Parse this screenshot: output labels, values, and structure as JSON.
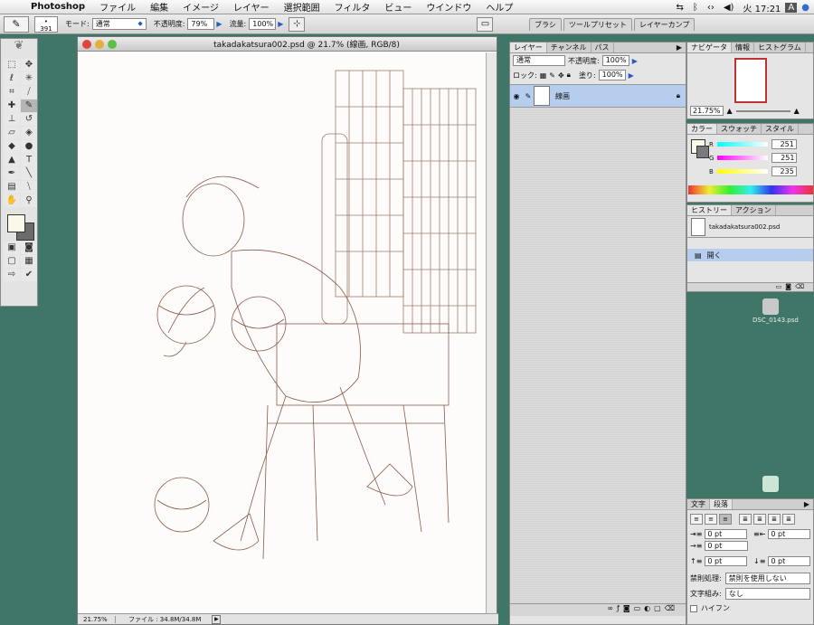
{
  "menubar": {
    "app": "Photoshop",
    "items": [
      "ファイル",
      "編集",
      "イメージ",
      "レイヤー",
      "選択範囲",
      "フィルタ",
      "ビュー",
      "ウインドウ",
      "ヘルプ"
    ],
    "clock": "火 17:21",
    "input_indicator": "A"
  },
  "options": {
    "brush_size": "391",
    "mode_label": "モード:",
    "mode_value": "通常",
    "opacity_label": "不透明度:",
    "opacity_value": "79%",
    "flow_label": "流量:",
    "flow_value": "100%"
  },
  "palette_well": {
    "tabs": [
      "ブラシ",
      "ツールプリセット",
      "レイヤーカンプ"
    ]
  },
  "document": {
    "title": "takadakatsura002.psd @ 21.7% (線画, RGB/8)",
    "zoom": "21.75%",
    "file_info": "ファイル : 34.8M/34.8M"
  },
  "layers_panel": {
    "tabs": [
      "レイヤー",
      "チャンネル",
      "パス"
    ],
    "blend_mode": "通常",
    "opacity_label": "不透明度:",
    "opacity": "100%",
    "lock_label": "ロック:",
    "fill_label": "塗り:",
    "fill": "100%",
    "layer_name": "線画"
  },
  "navigator_panel": {
    "tabs": [
      "ナビゲータ",
      "情報",
      "ヒストグラム"
    ],
    "zoom": "21.75%"
  },
  "color_panel": {
    "tabs": [
      "カラー",
      "スウォッチ",
      "スタイル"
    ],
    "channels": [
      {
        "name": "R",
        "value": "251",
        "color": "#2fd0c8"
      },
      {
        "name": "G",
        "value": "251",
        "color": "#d23ad2"
      },
      {
        "name": "B",
        "value": "235",
        "color": "#e8e23a"
      }
    ]
  },
  "history_panel": {
    "tabs": [
      "ヒストリー",
      "アクション"
    ],
    "snapshot": "takadakatsura002.psd",
    "items": [
      "開く"
    ]
  },
  "desktop": {
    "icon1": "DSC_0143.psd"
  },
  "paragraph_panel": {
    "tabs": [
      "文字",
      "段落"
    ],
    "indent_left": "0 pt",
    "indent_right": "0 pt",
    "indent_first": "0 pt",
    "space_before": "0 pt",
    "space_after": "0 pt",
    "kinsoku_label": "禁則処理:",
    "kinsoku_value": "禁則を使用しない",
    "mojikumi_label": "文字組み:",
    "mojikumi_value": "なし",
    "hyphen_label": "ハイフン"
  }
}
